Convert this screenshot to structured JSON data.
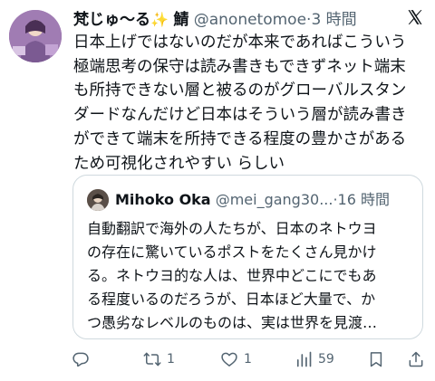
{
  "author": {
    "display_name": "梵じゅ〜る",
    "sparkle": "✨",
    "name_suffix": "鯖",
    "handle": "@anonetomoe",
    "separator": "·",
    "time": "3 時間"
  },
  "post": {
    "lines": [
      "日本上げではないのだが本来であればこういう",
      "極端思考の保守は読み書きもできずネット端末",
      "も所持できない層と被るのがグローバルスタン",
      "ダードなんだけど日本はそういう層が読み書き",
      "ができて端末を所持できる程度の豊かさがある",
      "ため可視化されやすい らしい"
    ]
  },
  "quote": {
    "name": "Mihoko Oka",
    "handle": "@mei_gang30...",
    "separator": "·",
    "time": "16 時間",
    "lines": [
      "自動翻訳で海外の人たちが、日本のネトウヨ",
      "の存在に驚いているポストをたくさん見かけ",
      "る。ネトウヨ的な人は、世界中どこにでもあ",
      "る程度いるのだろうが、日本ほど大量で、か",
      "つ愚劣なレベルのものは、実は世界を見渡…"
    ]
  },
  "actions": {
    "reply_count": "",
    "retweet_count": "1",
    "like_count": "1",
    "views_count": "59"
  },
  "icons": {
    "platform_logo": "x-logo-icon",
    "reply": "reply-icon",
    "retweet": "retweet-icon",
    "like": "heart-icon",
    "views": "views-chart-icon",
    "bookmark": "bookmark-icon",
    "share": "share-icon"
  },
  "colors": {
    "text": "#0f1419",
    "secondary": "#536471",
    "border": "#cfd9de",
    "sparkle": "#f5b800"
  }
}
